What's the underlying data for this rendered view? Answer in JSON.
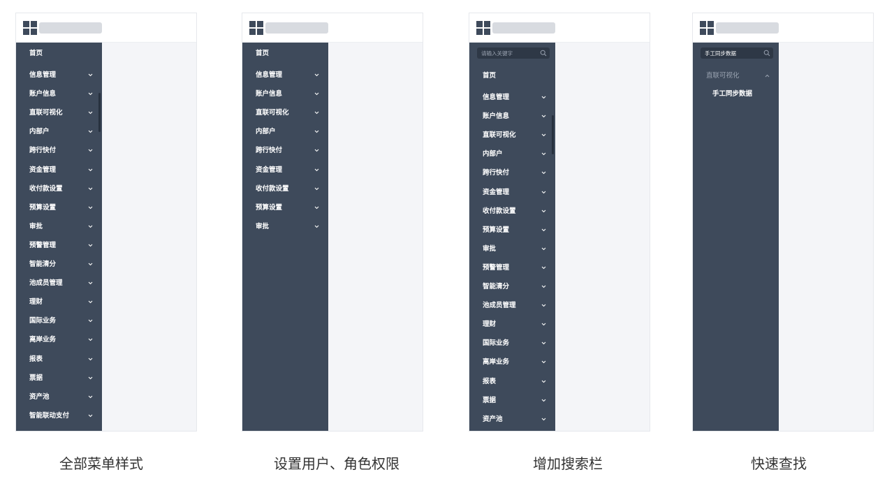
{
  "icons": {
    "logo": "grid-logo-icon",
    "chevron_down": "chevron-down-icon",
    "chevron_up": "chevron-up-icon",
    "search": "search-icon"
  },
  "colors": {
    "sidebar_bg": "#3e4a5b",
    "content_bg": "#f4f5f8",
    "title_placeholder": "#d8dbe0",
    "menu_text": "#ffffff",
    "muted_text": "#9aa3b1"
  },
  "panels": [
    {
      "caption": "全部菜单样式",
      "home": "首页",
      "items": [
        "信息管理",
        "账户信息",
        "直联可视化",
        "内部户",
        "跨行快付",
        "资金管理",
        "收付款设置",
        "预算设置",
        "审批",
        "预警管理",
        "智能清分",
        "池成员管理",
        "理财",
        "国际业务",
        "离岸业务",
        "报表",
        "票据",
        "资产池",
        "智能联动支付"
      ]
    },
    {
      "caption": "设置用户、角色权限",
      "home": "首页",
      "items": [
        "信息管理",
        "账户信息",
        "直联可视化",
        "内部户",
        "跨行快付",
        "资金管理",
        "收付款设置",
        "预算设置",
        "审批"
      ]
    },
    {
      "caption": "增加搜索栏",
      "search_placeholder": "请输入关键字",
      "home": "首页",
      "items": [
        "信息管理",
        "账户信息",
        "直联可视化",
        "内部户",
        "跨行快付",
        "资金管理",
        "收付款设置",
        "预算设置",
        "审批",
        "预警管理",
        "智能清分",
        "池成员管理",
        "理财",
        "国际业务",
        "离岸业务",
        "报表",
        "票据",
        "资产池"
      ]
    },
    {
      "caption": "快速查找",
      "search_value": "手工同步数据",
      "group": "直联可视化",
      "result": "手工同步数据"
    }
  ]
}
